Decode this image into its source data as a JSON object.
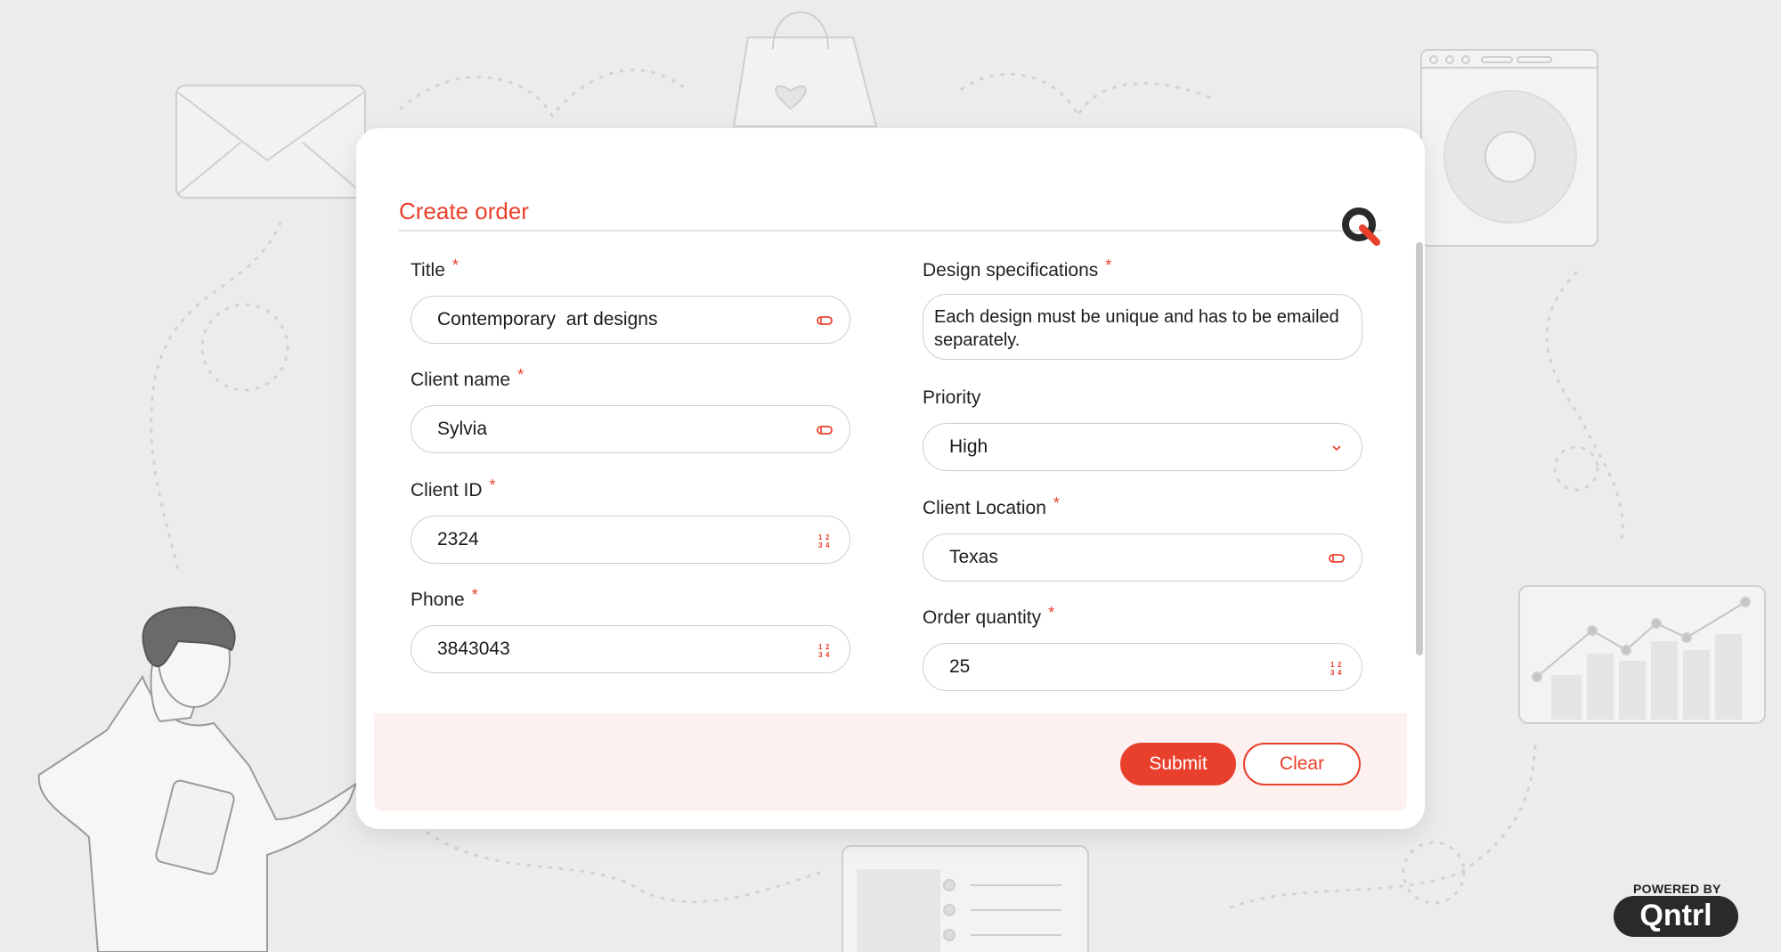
{
  "form": {
    "title": "Create order",
    "fields": {
      "title": {
        "label": "Title",
        "required_mark": "*",
        "value": "Contemporary  art designs",
        "icon": "text-input-icon"
      },
      "client_name": {
        "label": "Client name",
        "required_mark": "*",
        "value": "Sylvia",
        "icon": "text-input-icon"
      },
      "client_id": {
        "label": "Client ID",
        "required_mark": "*",
        "value": "2324",
        "icon": "number-input-icon"
      },
      "phone": {
        "label": "Phone",
        "required_mark": "*",
        "value": "3843043",
        "icon": "number-input-icon"
      },
      "design_specifications": {
        "label": "Design specifications",
        "required_mark": "*",
        "value": "Each design must be unique and has to be emailed separately."
      },
      "priority": {
        "label": "Priority",
        "value": "High",
        "icon": "chevron-down-icon"
      },
      "client_location": {
        "label": "Client Location",
        "required_mark": "*",
        "value": "Texas",
        "icon": "text-input-icon"
      },
      "order_quantity": {
        "label": "Order quantity",
        "required_mark": "*",
        "value": "25",
        "icon": "number-input-icon"
      }
    },
    "buttons": {
      "submit": "Submit",
      "clear": "Clear"
    }
  },
  "branding": {
    "powered_by": "POWERED BY",
    "brand": "Qntrl"
  },
  "colors": {
    "accent": "#e8402c",
    "background": "#ececec",
    "footer_band": "#fcf1ef",
    "card": "#ffffff"
  }
}
